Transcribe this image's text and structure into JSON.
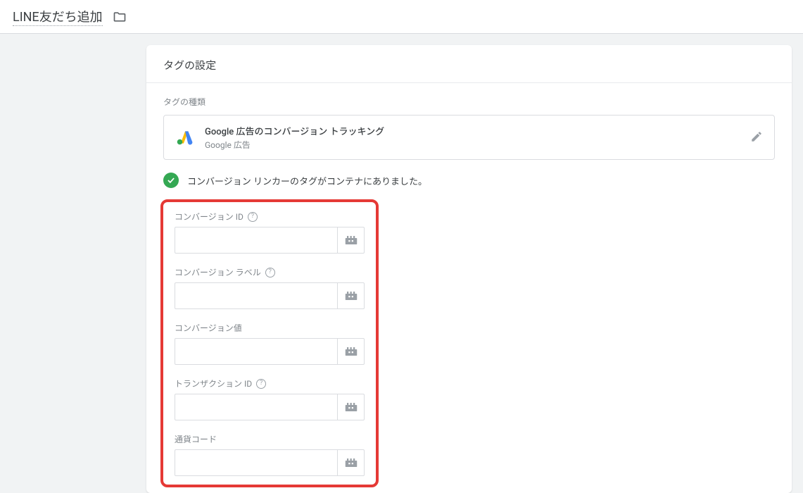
{
  "header": {
    "title": "LINE友だち追加"
  },
  "card": {
    "title": "タグの設定",
    "tag_type_section_label": "タグの種類",
    "tag_type": {
      "title": "Google 広告のコンバージョン トラッキング",
      "subtitle": "Google 広告"
    },
    "status_message": "コンバージョン リンカーのタグがコンテナにありました。"
  },
  "fields": {
    "conversion_id": {
      "label": "コンバージョン ID",
      "value": "",
      "has_help": true
    },
    "conversion_label": {
      "label": "コンバージョン ラベル",
      "value": "",
      "has_help": true
    },
    "conversion_value": {
      "label": "コンバージョン値",
      "value": "",
      "has_help": false
    },
    "transaction_id": {
      "label": "トランザクション ID",
      "value": "",
      "has_help": true
    },
    "currency_code": {
      "label": "通貨コード",
      "value": "",
      "has_help": false
    }
  }
}
